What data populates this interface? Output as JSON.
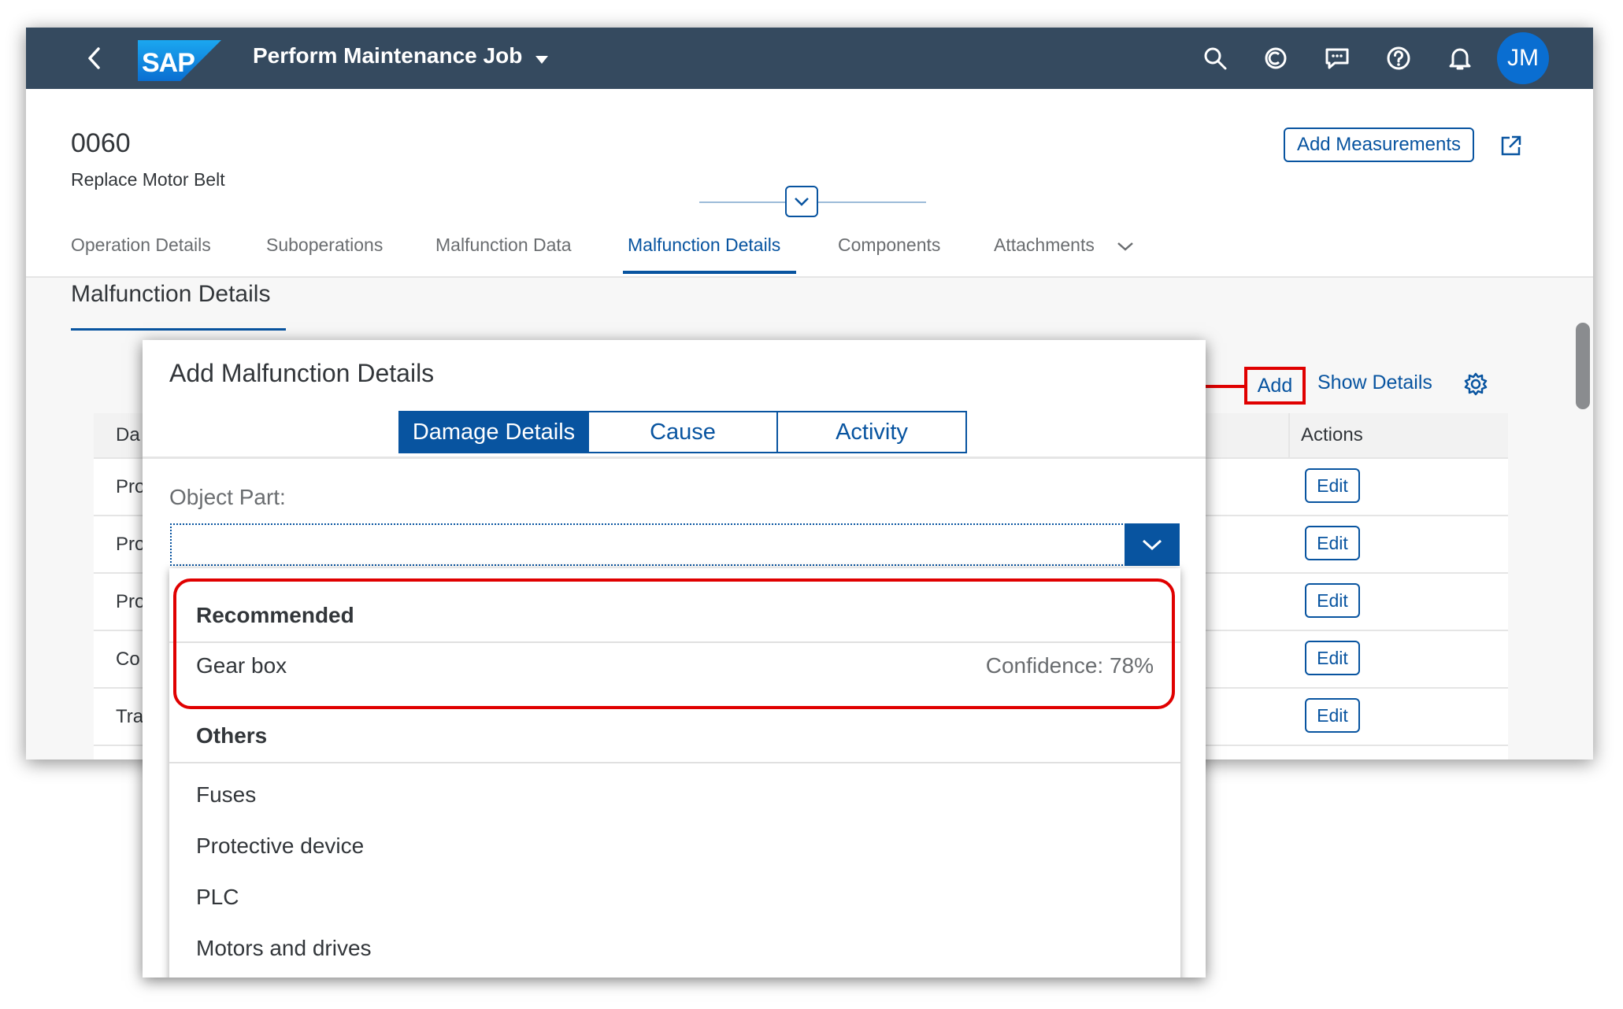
{
  "shell": {
    "title": "Perform Maintenance Job",
    "avatar_initials": "JM",
    "icons": [
      "back-icon",
      "sap-logo",
      "title-dropdown-icon",
      "search-icon",
      "copilot-icon",
      "feedback-icon",
      "help-icon",
      "bell-icon"
    ]
  },
  "header": {
    "object_id": "0060",
    "object_subtitle": "Replace Motor Belt",
    "add_measurements_label": "Add Measurements"
  },
  "tabs": [
    {
      "label": "Operation Details"
    },
    {
      "label": "Suboperations"
    },
    {
      "label": "Malfunction Data"
    },
    {
      "label": "Malfunction Details",
      "active": true
    },
    {
      "label": "Components"
    },
    {
      "label": "Attachments"
    }
  ],
  "section": {
    "title": "Malfunction Details",
    "add_label": "Add",
    "show_details_label": "Show Details"
  },
  "table": {
    "first_col_header_partial": "Da",
    "actions_header": "Actions",
    "rows": [
      {
        "first_col_partial": "Pro",
        "action": "Edit"
      },
      {
        "first_col_partial": "Pro",
        "action": "Edit"
      },
      {
        "first_col_partial": "Pro",
        "action": "Edit"
      },
      {
        "first_col_partial": "Co",
        "action": "Edit"
      },
      {
        "first_col_partial": "Tra",
        "action": "Edit"
      }
    ]
  },
  "dialog": {
    "title": "Add Malfunction Details",
    "segments": [
      {
        "label": "Damage Details",
        "active": true
      },
      {
        "label": "Cause"
      },
      {
        "label": "Activity"
      }
    ],
    "field_label": "Object Part:",
    "field_value": "",
    "dropdown": {
      "recommended_header": "Recommended",
      "recommended_item": "Gear box",
      "confidence": "Confidence: 78%",
      "others_header": "Others",
      "others": [
        "Fuses",
        "Protective device",
        "PLC",
        "Motors and drives"
      ]
    }
  },
  "colors": {
    "shell_bg": "#354a5f",
    "brand_blue": "#0854a0",
    "annotation_red": "#e00000"
  }
}
